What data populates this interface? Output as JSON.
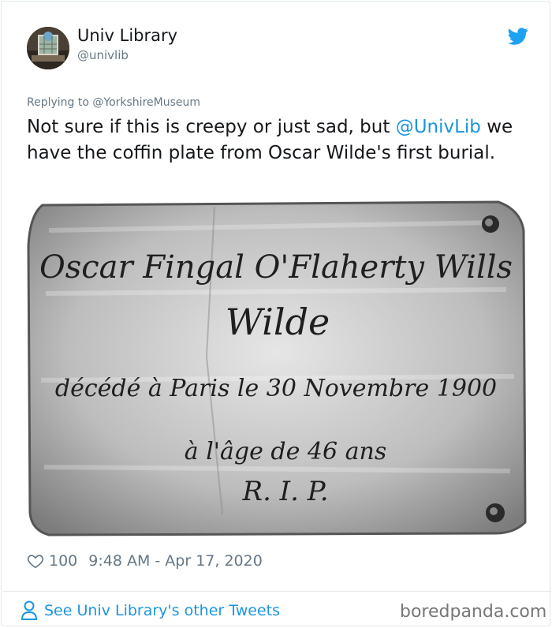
{
  "user": {
    "name": "Univ Library",
    "handle": "@univlib"
  },
  "reply": {
    "prefix": "Replying to",
    "mention": "@YorkshireMuseum"
  },
  "tweet": {
    "text_before": "Not sure if this is creepy or just sad, but ",
    "mention": "@UnivLib",
    "text_after": " we have the coffin plate from Oscar Wilde's first burial."
  },
  "photo": {
    "lines": [
      "Oscar Fingal O'Flaherty Wills",
      "Wilde",
      "décédé à Paris le 30 Novembre 1900",
      "à l'âge de 46 ans",
      "R. I. P."
    ]
  },
  "stats": {
    "likes": "100",
    "timestamp": "9:48 AM - Apr 17, 2020"
  },
  "footer": {
    "see_more": "See Univ Library's other Tweets",
    "watermark": "boredpanda.com"
  },
  "colors": {
    "link": "#1b95e0",
    "muted": "#657786",
    "text": "#14171a",
    "twitter_blue": "#1da1f2"
  },
  "icons": {
    "brand": "twitter-bird-icon",
    "like": "heart-icon",
    "profile": "person-icon"
  }
}
